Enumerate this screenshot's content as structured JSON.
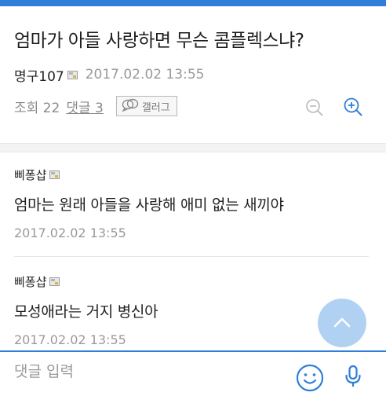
{
  "post": {
    "title": "엄마가 아들 사랑하면 무슨 콤플렉스냐?",
    "author": "명구107",
    "date": "2017.02.02 13:55",
    "views_label": "조회 22",
    "comments_label": "댓글 3",
    "gallery_label": "갤러그"
  },
  "comments": [
    {
      "author": "삐퐁샵",
      "text": "엄마는 원래 아들을 사랑해 애미 없는 새끼야",
      "date": "2017.02.02 13:55"
    },
    {
      "author": "삐퐁샵",
      "text": "모성애라는 거지 병신아",
      "date": "2017.02.02 13:55"
    }
  ],
  "input": {
    "placeholder": "댓글 입력"
  },
  "icons": {
    "zoom_out": "zoom-out-icon",
    "zoom_in": "zoom-in-icon",
    "scroll_top": "chevron-up-icon",
    "emoji": "emoji-icon",
    "mic": "microphone-icon",
    "cafe_badge": "cafe-badge-icon",
    "gallery": "gallery-icon"
  },
  "colors": {
    "accent": "#2f7fd8",
    "scroll_button": "#a9cdf2"
  }
}
